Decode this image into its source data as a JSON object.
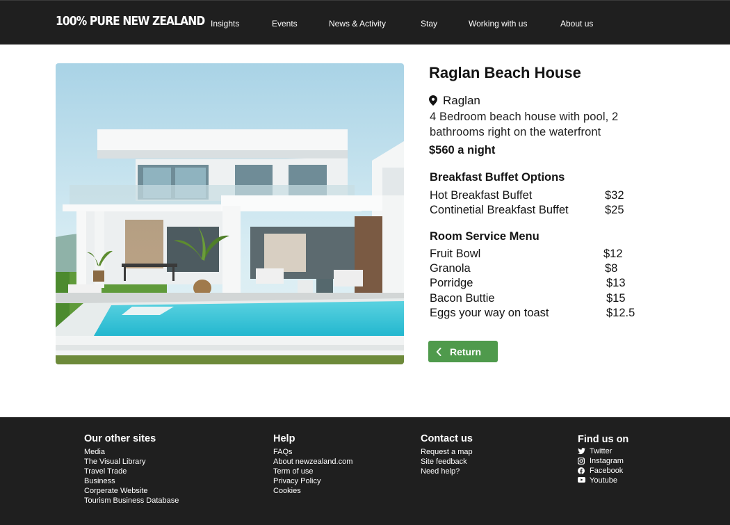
{
  "header": {
    "logo": "100% PURE NEW ZEALAND",
    "nav": [
      {
        "label": "Insights"
      },
      {
        "label": "Events"
      },
      {
        "label": "News & Activity"
      },
      {
        "label": "Stay"
      },
      {
        "label": "Working with us"
      },
      {
        "label": "About us"
      }
    ]
  },
  "listing": {
    "photo_icon": "beach-house-photo",
    "title": "Raglan Beach House",
    "location_icon": "map-pin-icon",
    "location": "Raglan",
    "description": "4 Bedroom beach house with pool, 2 bathrooms right on the waterfront",
    "price": "$560 a night"
  },
  "breakfast": {
    "title": "Breakfast Buffet Options",
    "items": [
      {
        "name": "Hot Breakfast Buffet",
        "price": "$32"
      },
      {
        "name": "Continetial Breakfast Buffet",
        "price": "$25"
      }
    ]
  },
  "room_service": {
    "title": "Room Service Menu",
    "items": [
      {
        "name": "Fruit Bowl",
        "price": "$12"
      },
      {
        "name": "Granola",
        "price": "$8"
      },
      {
        "name": "Porridge",
        "price": "$13"
      },
      {
        "name": "Bacon Buttie",
        "price": "$15"
      },
      {
        "name": "Eggs your way on toast",
        "price": "$12.5"
      }
    ]
  },
  "return_button": {
    "label": "Return",
    "icon": "chevron-left-icon",
    "color": "#4f9a4c"
  },
  "footer": {
    "other_sites": {
      "title": "Our other sites",
      "links": [
        "Media",
        "The Visual Library",
        "Travel Trade",
        "Business",
        "Corperate Website",
        "Tourism Business Database"
      ]
    },
    "help": {
      "title": "Help",
      "links": [
        "FAQs",
        "About newzealand.com",
        "Term of use",
        "Privacy Policy",
        "Cookies"
      ]
    },
    "contact": {
      "title": "Contact us",
      "links": [
        "Request a map",
        "Site feedback",
        "Need help?"
      ]
    },
    "find_us": {
      "title": "Find us on",
      "links": [
        {
          "label": "Twitter",
          "icon": "twitter-icon"
        },
        {
          "label": "Instagram",
          "icon": "instagram-icon"
        },
        {
          "label": "Facebook",
          "icon": "facebook-icon"
        },
        {
          "label": "Youtube",
          "icon": "youtube-icon"
        }
      ]
    }
  },
  "colors": {
    "header_bg": "#1f1f1f",
    "footer_bg": "#1f1f1f",
    "accent_green": "#4f9a4c"
  }
}
